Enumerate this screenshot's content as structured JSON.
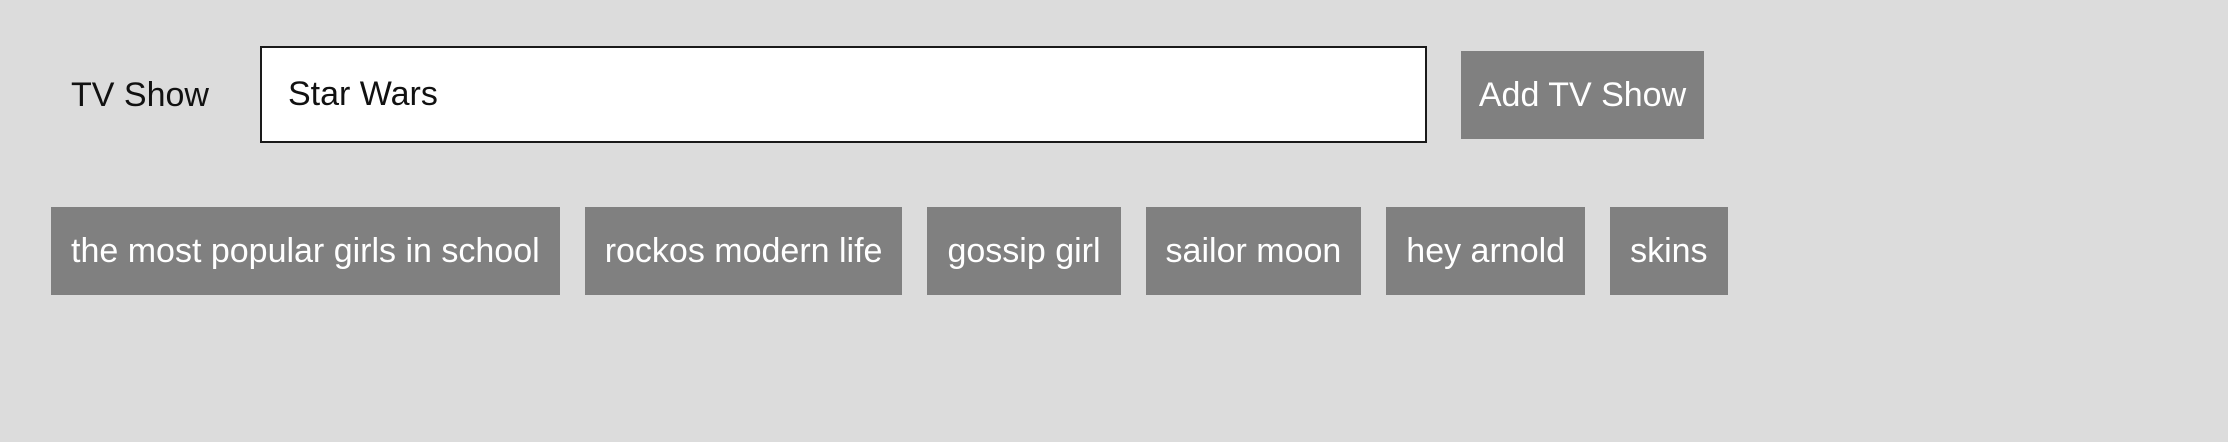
{
  "form": {
    "label": "TV Show",
    "input_value": "Star Wars",
    "add_button_label": "Add TV Show"
  },
  "shows": [
    "the most popular girls in school",
    "rockos modern life",
    "gossip girl",
    "sailor moon",
    "hey arnold",
    "skins"
  ],
  "colors": {
    "background": "#dcdcdc",
    "button": "#808080",
    "button_text": "#ffffff",
    "input_border": "#1a1a1a"
  }
}
